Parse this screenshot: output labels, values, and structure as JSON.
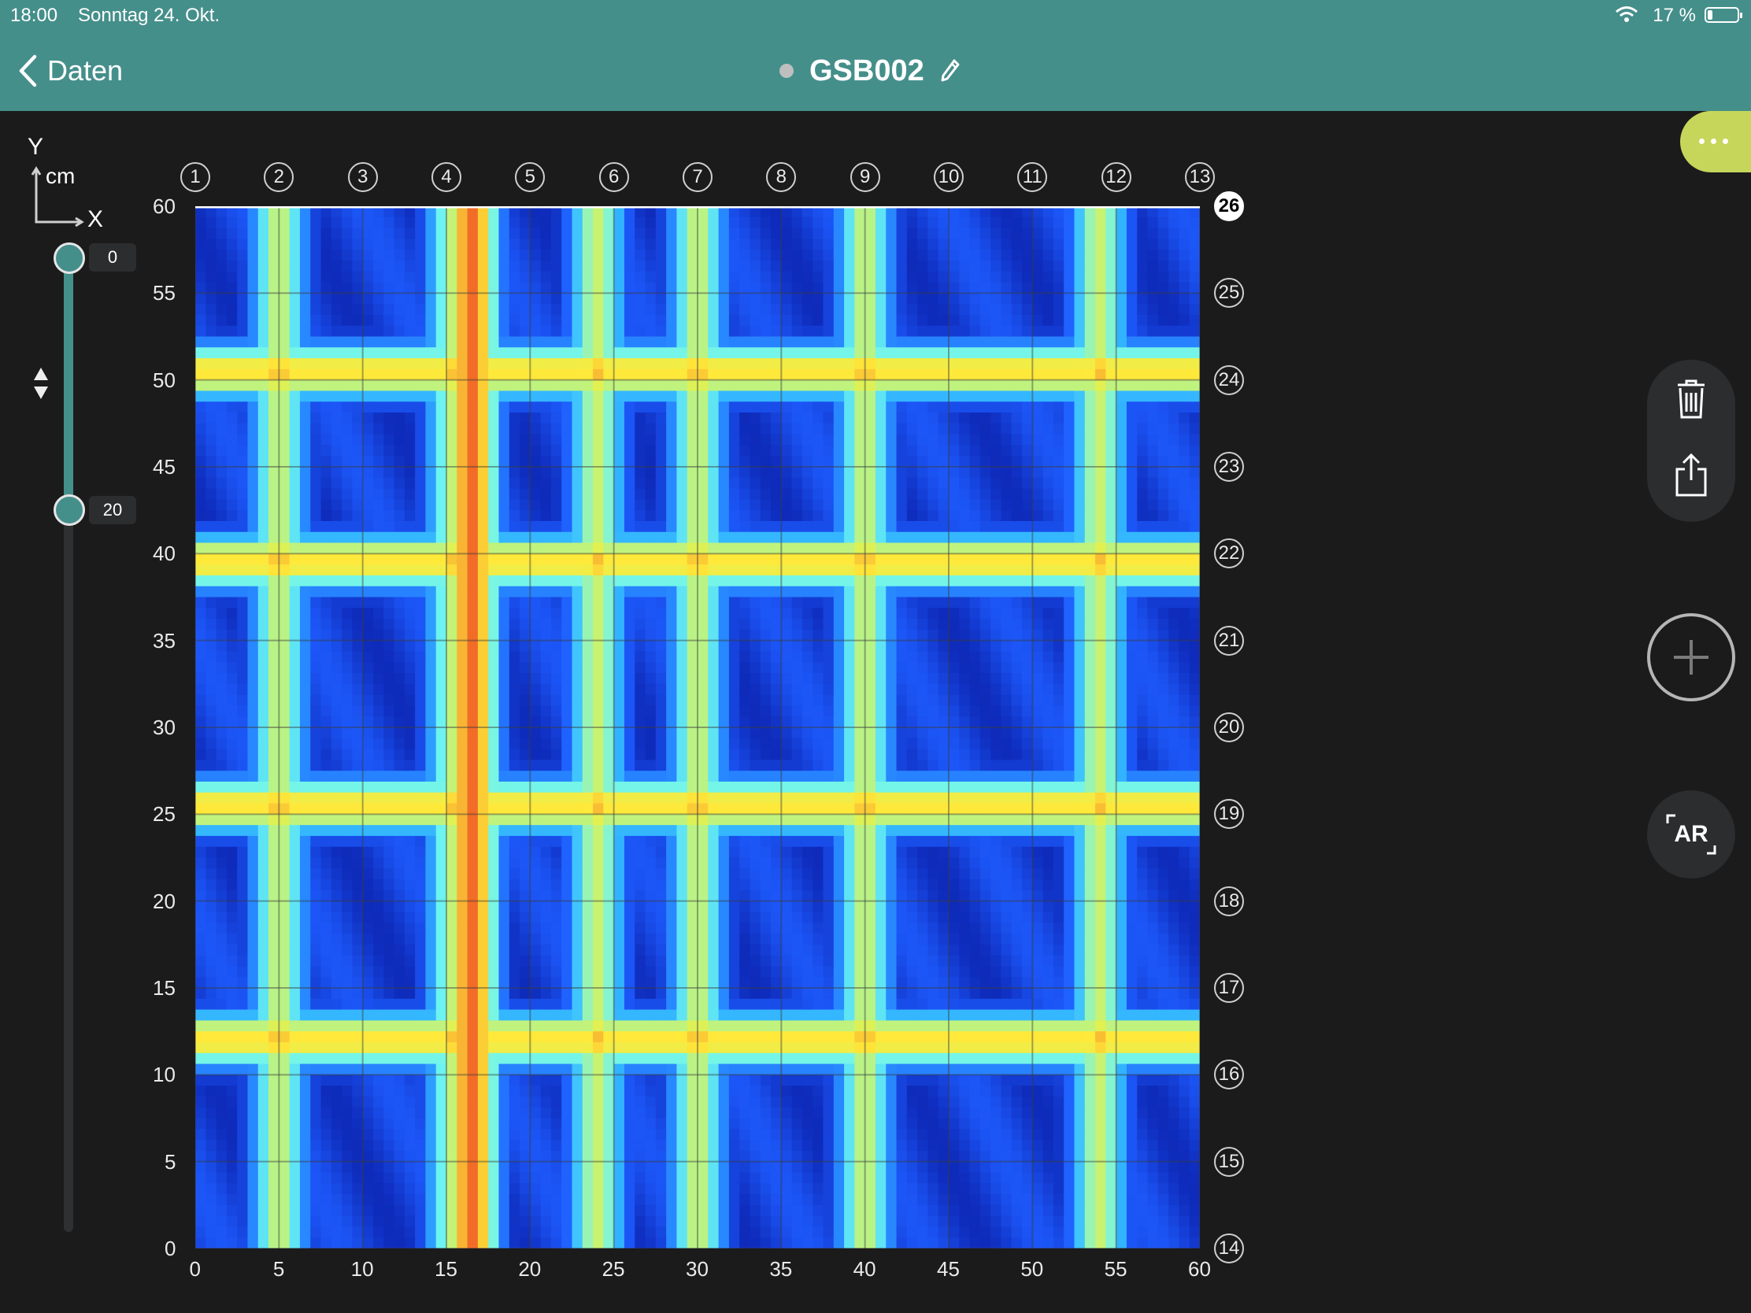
{
  "status_bar": {
    "time": "18:00",
    "date": "Sonntag 24. Okt.",
    "battery": "17 %",
    "battery_level": 0.17
  },
  "nav": {
    "back_label": "Daten",
    "title": "GSB002"
  },
  "axes": {
    "y_label": "Y",
    "unit": "cm",
    "x_label": "X"
  },
  "slider": {
    "upper_value": "0",
    "lower_value": "20",
    "max": 60
  },
  "chart_data": {
    "type": "heatmap",
    "xlim": [
      0,
      60
    ],
    "ylim": [
      0,
      60
    ],
    "x_ticks": [
      "0",
      "5",
      "10",
      "15",
      "20",
      "25",
      "30",
      "35",
      "40",
      "45",
      "50",
      "55",
      "60"
    ],
    "y_ticks": [
      "60",
      "55",
      "50",
      "45",
      "40",
      "35",
      "30",
      "25",
      "20",
      "15",
      "10",
      "5",
      "0"
    ],
    "x_values": [
      0,
      5,
      10,
      15,
      20,
      25,
      30,
      35,
      40,
      45,
      50,
      55,
      60
    ],
    "y_values": [
      60,
      55,
      50,
      45,
      40,
      35,
      30,
      25,
      20,
      15,
      10,
      5,
      0
    ],
    "column_lines": [
      "1",
      "2",
      "3",
      "4",
      "5",
      "6",
      "7",
      "8",
      "9",
      "10",
      "11",
      "12",
      "13"
    ],
    "row_lines": [
      "26",
      "25",
      "24",
      "23",
      "22",
      "21",
      "20",
      "19",
      "18",
      "17",
      "16",
      "15",
      "14"
    ],
    "active_row": "26",
    "colorscale": [
      "#0a1ea8",
      "#1e5cff",
      "#33b6ff",
      "#6ff5f0",
      "#d8f25a",
      "#ffe93a",
      "#f6a531",
      "#ee4b22"
    ],
    "vertical_bars_x_cm": [
      5,
      15.5,
      24,
      30,
      40,
      54
    ],
    "horizontal_bars_y_cm": [
      50.5,
      39.5,
      25.5,
      12
    ],
    "hotspot_bar_x_cm": 16.5
  }
}
